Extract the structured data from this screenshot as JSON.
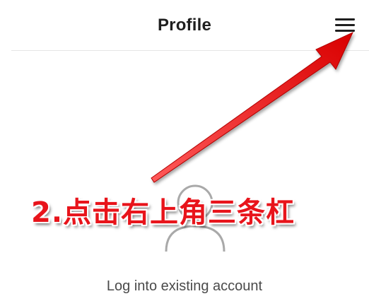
{
  "header": {
    "title": "Profile",
    "menu_icon": "hamburger-menu-icon"
  },
  "main": {
    "avatar_icon": "user-avatar-placeholder-icon",
    "login_link": "Log into existing account"
  },
  "annotation": {
    "text": "2.点击右上角三条杠",
    "color": "#e8141b",
    "arrow_icon": "red-arrow-pointing-to-menu"
  },
  "colors": {
    "title_text": "#1f1f1f",
    "body_text": "#4a4a4a",
    "divider": "#e6e6e6",
    "avatar_stroke": "#a9a9a9",
    "annotation": "#e8141b"
  }
}
